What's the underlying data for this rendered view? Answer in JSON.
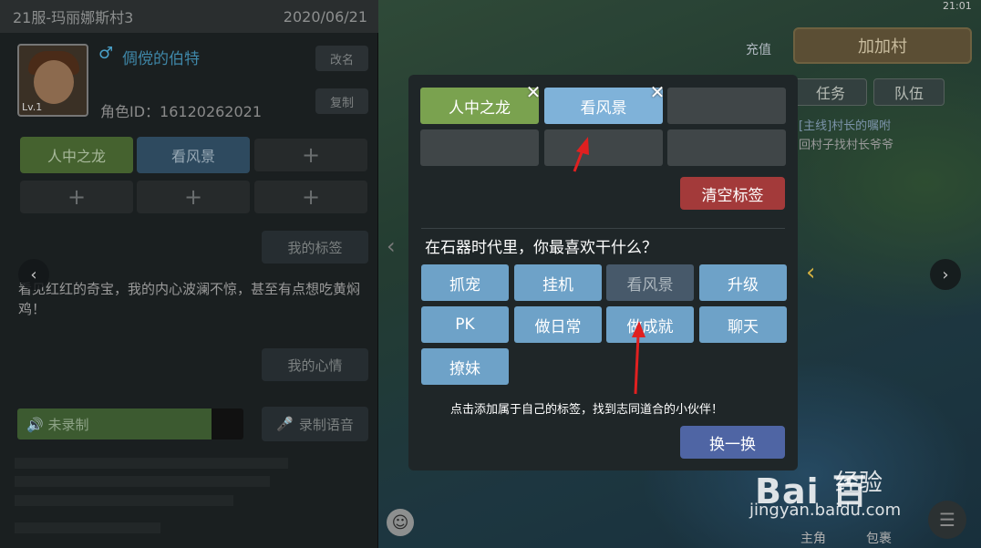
{
  "left_panel": {
    "server": "21服-玛丽娜斯村3",
    "date": "2020/06/21",
    "level": "Lv.1",
    "gender_icon": "♂",
    "name": "倜傥的伯特",
    "rename_label": "改名",
    "role_id": "角色ID：16120262021",
    "copy_label": "复制",
    "tags": [
      "人中之龙",
      "看风景",
      "+",
      "+",
      "+",
      "+"
    ],
    "my_tags_label": "我的标签",
    "mood_text": "看见红红的奇宝，我的内心波澜不惊，甚至有点想吃黄焖鸡！",
    "my_mood_label": "我的心情",
    "record_status": "未录制",
    "record_progress": 0.86,
    "record_voice_label": "录制语音"
  },
  "hud": {
    "clock": "21:01",
    "recharge_label": "充值",
    "village_button": "加加村",
    "tab_task": "任务",
    "tab_team": "队伍",
    "quest_line1": "[主线]村长的嘱咐",
    "quest_line2": "回村子找村长爷爷",
    "bottom_left_label": "主角",
    "bottom_right_label": "包裹"
  },
  "modal": {
    "selected_tags": [
      {
        "label": "人中之龙",
        "color": "#7aa24f"
      },
      {
        "label": "看风景",
        "color": "#7fb2d9"
      },
      {
        "label": ""
      },
      {
        "label": ""
      },
      {
        "label": ""
      },
      {
        "label": ""
      }
    ],
    "close_glyph": "✕",
    "clear_button": "清空标签",
    "question": "在石器时代里，你最喜欢干什么？",
    "options": [
      "抓宠",
      "挂机",
      "看风景",
      "升级",
      "PK",
      "做日常",
      "做成就",
      "聊天",
      "撩妹"
    ],
    "selected_option": "看风景",
    "hint": "点击添加属于自己的标签，找到志同道合的小伙伴！",
    "swap_button": "换一换"
  },
  "watermark": {
    "logo": "Bai 百",
    "sub": "经验",
    "url": "jingyan.baidu.com"
  },
  "colors": {
    "tag_green": "#7aa24f",
    "tag_blue": "#7fb2d9",
    "option_blue": "#6ea2c8",
    "clear_red": "#a33a3a",
    "swap_blue": "#4f65a4",
    "annotation_red": "#e02020"
  }
}
